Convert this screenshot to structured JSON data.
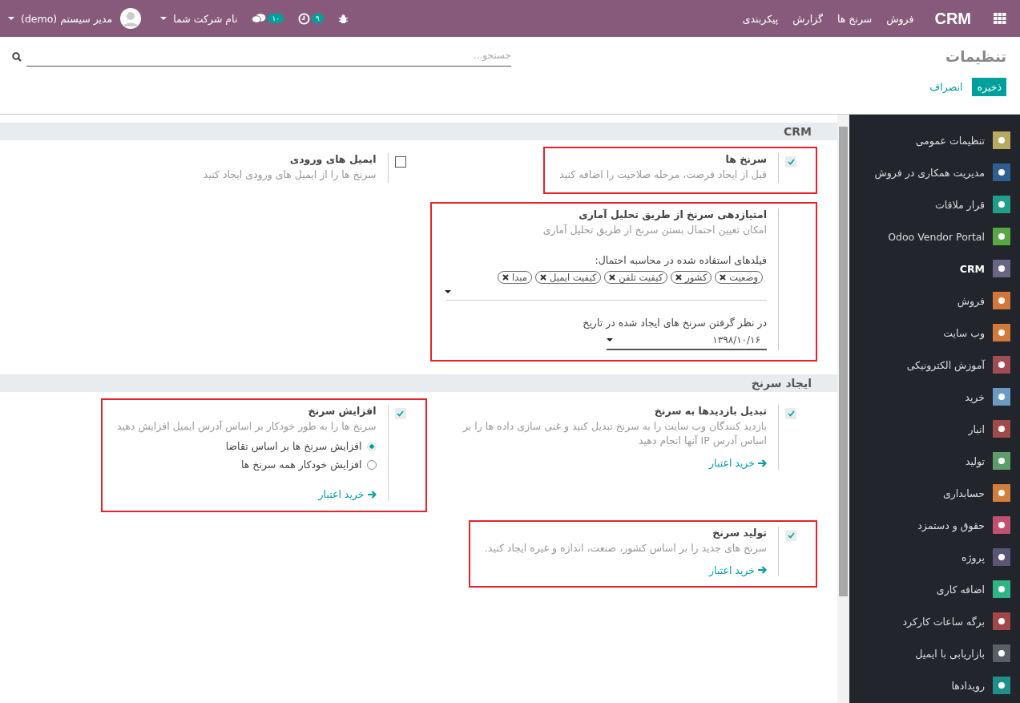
{
  "navbar": {
    "brand": "CRM",
    "menus": [
      "فروش",
      "سرنخ ها",
      "گزارش",
      "پیکربندی"
    ],
    "activity_count": "۹",
    "message_count": "۱۰",
    "company": "نام شرکت شما",
    "user": "مدیر سیستم (demo)"
  },
  "control_panel": {
    "title": "تنظیمات",
    "search": {
      "placeholder": "جستجو..."
    },
    "buttons": [
      {
        "label": "ذخیره",
        "kind": "primary"
      },
      {
        "label": "انصراف",
        "kind": "secondary"
      }
    ]
  },
  "sections": [
    {
      "title": "CRM",
      "settings": [
        {
          "title": "سرنخ ها",
          "description": "قبل از ایجاد فرصت، مرحله صلاحیت را اضافه کنید",
          "checked": true,
          "highlighted": true
        },
        {
          "title": "ایمیل های ورودی",
          "description": "سرنخ ها را از ایمیل های ورودی ایجاد کنید",
          "checked": false,
          "highlighted": false
        },
        {
          "title": "امتیازدهی سرنخ از طریق تحلیل آماری",
          "description": "امکان تعیین احتمال بستن سرنخ از طریق تحلیل آماری",
          "highlighted": true,
          "fields_label": "فیلدهای استفاده شده در محاسبه احتمال:",
          "tags": [
            "وضعیت",
            "کشور",
            "کیفیت تلفن",
            "کیفیت ایمیل",
            "مبدا"
          ],
          "date_label": "در نظر گرفتن سرنخ های ایجاد شده در تاریخ",
          "date_value": "۱۳۹۸/۱۰/۱۶"
        }
      ]
    },
    {
      "title": "ایجاد سرنخ",
      "settings": [
        {
          "title": "تبدیل بازدیدها به سرنخ",
          "description": "بازدید کنندگان وب سایت را به سرنخ تبدیل کنید و غنی سازی داده ها را بر اساس آدرس IP آنها انجام دهید",
          "checked": true,
          "highlighted": false,
          "link": "خرید اعتبار"
        },
        {
          "title": "افزایش سرنخ",
          "description": "سرنخ ها را به طور خودکار بر اساس آدرس ایمیل افزایش دهید",
          "checked": true,
          "highlighted": true,
          "options": [
            {
              "label": "افزایش سرنخ ها بر اساس تقاضا",
              "selected": true
            },
            {
              "label": "افزایش خودکار همه سرنخ ها",
              "selected": false
            }
          ],
          "link": "خرید اعتبار"
        },
        {
          "title": "تولید سرنخ",
          "description": "سرنخ های جدید را بر اساس کشور، صنعت، اندازه و غیره ایجاد کنید.",
          "checked": true,
          "highlighted": true,
          "link": "خرید اعتبار"
        }
      ]
    }
  ],
  "sidebar": {
    "items": [
      {
        "label": "تنظیمات عمومی",
        "color": "#b8a960",
        "selected": false
      },
      {
        "label": "مدیریت همکاری در فروش",
        "color": "#2f5f8f",
        "selected": false
      },
      {
        "label": "قرار ملاقات",
        "color": "#1f9e8a",
        "selected": false
      },
      {
        "label": "Odoo Vendor Portal",
        "color": "#57a845",
        "selected": false
      },
      {
        "label": "CRM",
        "color": "#6b6584",
        "selected": true
      },
      {
        "label": "فروش",
        "color": "#d2763a",
        "selected": false
      },
      {
        "label": "وب سایت",
        "color": "#d27a3a",
        "selected": false
      },
      {
        "label": "آموزش الکترونیکی",
        "color": "#a24d55",
        "selected": false
      },
      {
        "label": "خرید",
        "color": "#6a9bc3",
        "selected": false
      },
      {
        "label": "انبار",
        "color": "#a04a4a",
        "selected": false
      },
      {
        "label": "تولید",
        "color": "#5e9d6a",
        "selected": false
      },
      {
        "label": "حسابداری",
        "color": "#d0803b",
        "selected": false
      },
      {
        "label": "حقوق و دستمزد",
        "color": "#c2506e",
        "selected": false
      },
      {
        "label": "پروژه",
        "color": "#5a5575",
        "selected": false
      },
      {
        "label": "اضافه کاری",
        "color": "#2fb486",
        "selected": false
      },
      {
        "label": "برگه ساعات کارکرد",
        "color": "#a04848",
        "selected": false
      },
      {
        "label": "بازاریابی با ایمیل",
        "color": "#5a5f66",
        "selected": false
      },
      {
        "label": "رویدادها",
        "color": "#1f8f8a",
        "selected": false
      }
    ]
  }
}
